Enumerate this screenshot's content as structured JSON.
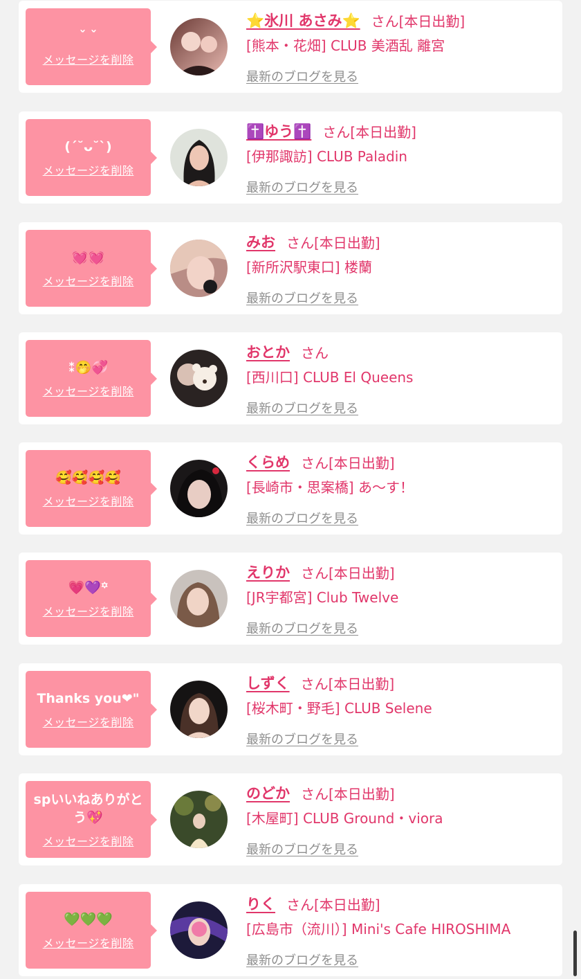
{
  "common": {
    "delete_label": "メッセージを削除",
    "blog_label": "最新のブログを見る",
    "san_label": "さん"
  },
  "colors": {
    "background": "#f2f2f2",
    "card": "#ffffff",
    "bubble": "#fd93a3",
    "accent": "#e1366a",
    "link_gray": "#8e8e8e"
  },
  "cards": [
    {
      "message": "ˇ ˇ",
      "name": "⭐氷川 あさみ⭐",
      "attendance": "[本日出勤]",
      "shop": "[熊本・花畑] CLUB 美酒乱 離宮"
    },
    {
      "message": "(ˊ˘ᴗ˘ˋ)",
      "name": "✝️ゆう✝️",
      "attendance": "[本日出勤]",
      "shop": "[伊那諏訪] CLUB Paladin"
    },
    {
      "message": "💓💓",
      "name": "みお",
      "attendance": "[本日出勤]",
      "shop": "[新所沢駅東口] 楼蘭"
    },
    {
      "message": "⁑🤭💞",
      "name": "おとか",
      "attendance": "",
      "shop": "[西川口] CLUB El Queens"
    },
    {
      "message": "🥰🥰🥰🥰",
      "name": "くらめ",
      "attendance": "[本日出勤]",
      "shop": "[長崎市・思案橋] あ〜す！"
    },
    {
      "message": "💗💜꙳",
      "name": "えりか",
      "attendance": "[本日出勤]",
      "shop": "[JR宇都宮] Club Twelve"
    },
    {
      "message": "Thanks you❤\"",
      "name": "しずく",
      "attendance": "[本日出勤]",
      "shop": "[桜木町・野毛] CLUB Selene"
    },
    {
      "message": "spいいねありがとう💖",
      "name": "のどか",
      "attendance": "[本日出勤]",
      "shop": "[木屋町] CLUB Ground・viora"
    },
    {
      "message": "💚💚💚",
      "name": "りく",
      "attendance": "[本日出勤]",
      "shop": "[広島市（流川）] Mini's Cafe HIROSHIMA"
    }
  ]
}
